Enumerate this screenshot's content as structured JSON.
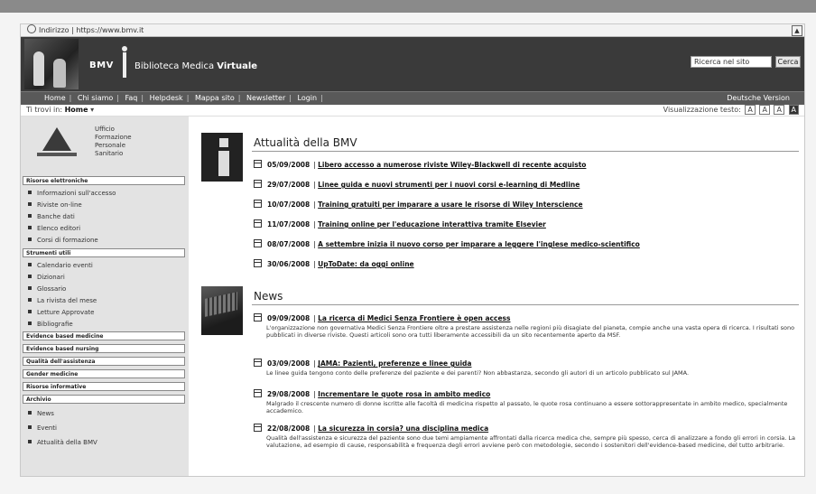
{
  "browser": {
    "address": "Indirizzo | https://www.bmv.it"
  },
  "header": {
    "brand_short": "BMV",
    "brand_light": "Biblioteca Medica ",
    "brand_bold": "Virtuale"
  },
  "search": {
    "value": "Ricerca nel sito",
    "button": "Cerca"
  },
  "nav": {
    "items": [
      "Home",
      "Chi siamo",
      "Faq",
      "Helpdesk",
      "Mappa sito",
      "Newsletter",
      "Login"
    ],
    "lang": "Deutsche Version"
  },
  "breadcrumb": {
    "prefix": "Ti trovi in:",
    "current": "Home"
  },
  "textsize": {
    "label": "Visualizzazione testo:",
    "options": [
      "A",
      "A",
      "A",
      "A"
    ]
  },
  "sidebar": {
    "logo_lines": [
      "Ufficio",
      "Formazione",
      "Personale",
      "Sanitario"
    ],
    "sections": [
      {
        "title": "Risorse elettroniche",
        "items": [
          "Informazioni sull'accesso",
          "Riviste on-line",
          "Banche dati",
          "Elenco editori",
          "Corsi di formazione"
        ]
      },
      {
        "title": "Strumenti utili",
        "items": [
          "Calendario eventi",
          "Dizionari",
          "Glossario",
          "La rivista del mese",
          "Letture Approvate",
          "Bibliografie"
        ]
      },
      {
        "title": "Evidence based medicine",
        "items": []
      },
      {
        "title": "Evidence based nursing",
        "items": []
      },
      {
        "title": "Qualità dell'assistenza",
        "items": []
      },
      {
        "title": "Gender medicine",
        "items": []
      },
      {
        "title": "Risorse informative",
        "items": []
      },
      {
        "title": "Archivio",
        "items": [
          "News",
          "Eventi",
          "Attualità della BMV"
        ]
      }
    ]
  },
  "attualita": {
    "title": "Attualità della BMV",
    "items": [
      {
        "date": "05/09/2008",
        "text": "Libero accesso a numerose riviste Wiley-Blackwell di recente acquisto"
      },
      {
        "date": "29/07/2008",
        "text": "Linee guida e nuovi strumenti per i nuovi corsi e-learning di Medline"
      },
      {
        "date": "10/07/2008",
        "text": "Training gratuiti per imparare a usare le risorse di Wiley Interscience"
      },
      {
        "date": "11/07/2008",
        "text": "Training online per l'educazione interattiva tramite Elsevier"
      },
      {
        "date": "08/07/2008",
        "text": "A settembre inizia il nuovo corso per imparare a leggere l'inglese medico-scientifico"
      },
      {
        "date": "30/06/2008",
        "text": "UpToDate: da oggi online"
      }
    ]
  },
  "news": {
    "title": "News",
    "items": [
      {
        "date": "09/09/2008",
        "headline": "La ricerca di Medici Senza Frontiere è open access",
        "desc": "L'organizzazione non governativa Medici Senza Frontiere oltre a prestare assistenza nelle regioni più disagiate del pianeta, compie anche una vasta opera di ricerca. I risultati sono pubblicati in diverse riviste. Questi articoli sono ora tutti liberamente accessibili da un sito recentemente aperto da MSF."
      },
      {
        "date": "03/09/2008",
        "headline": "JAMA: Pazienti, preferenze e linee guida",
        "desc": "Le linee guida tengono conto delle preferenze del paziente e dei parenti? Non abbastanza, secondo gli autori di un articolo pubblicato sul JAMA."
      },
      {
        "date": "29/08/2008",
        "headline": "Incrementare le quote rosa in ambito medico",
        "desc": "Malgrado il crescente numero di donne iscritte alle facoltà di medicina rispetto al passato, le quote rosa continuano a essere sottorappresentate in ambito medico, specialmente accademico."
      },
      {
        "date": "22/08/2008",
        "headline": "La sicurezza in corsia? una disciplina medica",
        "desc": "Qualità dell'assistenza e sicurezza del paziente sono due temi ampiamente affrontati dalla ricerca medica che, sempre più spesso, cerca di analizzare a fondo gli errori in corsia. La valutazione, ad esempio di cause, responsabilità e frequenza degli errori avviene però con metodologie, secondo i sostenitori dell'evidence-based medicine, del tutto arbitrarie."
      }
    ]
  }
}
